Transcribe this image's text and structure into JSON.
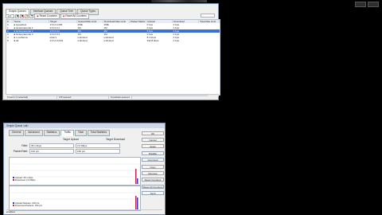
{
  "main": {
    "tabs": [
      "Simple Queues",
      "Interface Queues",
      "Queue Tree",
      "Queue Types"
    ],
    "toolbar": {
      "reset_counters": "Reset Counters",
      "reset_all_counters": "Reset All Counters",
      "search_placeholder": "Find"
    },
    "columns": [
      "#",
      "Name",
      "Target",
      "Upload Max Limit",
      "Download Max Limit",
      "Packet Marks",
      "Upload",
      "Download",
      "Total Max Limit"
    ],
    "rows": [
      {
        "num": "0",
        "name": "speedtest",
        "target": "172.2.0.254",
        "up": "256k",
        "down": "256k",
        "marks": "",
        "upload": "0 bps",
        "download": "0 bps",
        "total": ""
      },
      {
        "num": "1",
        "name": "limiterparental 1",
        "target": "172.2.0.1",
        "up": "1M",
        "down": "1M",
        "marks": "",
        "upload": "0 bps",
        "download": "0 bps",
        "total": ""
      },
      {
        "num": "2",
        "name": "limiterparental 2",
        "target": "172.2.0.2",
        "up": "2M",
        "down": "2M",
        "marks": "",
        "upload": "5 bps",
        "download": "0 bps",
        "total": ""
      },
      {
        "num": "3",
        "name": "limiterparental 3",
        "target": "172.2.0.3",
        "up": "1M",
        "down": "1M",
        "marks": "",
        "upload": "0 bps",
        "download": "0 bps",
        "total": ""
      },
      {
        "num": "4",
        "name": "c-netherna",
        "target": "ether1",
        "up": "unlimited",
        "down": "unlimited",
        "marks": "",
        "upload": "8.4 kbps",
        "download": "0 bps",
        "total": ""
      },
      {
        "num": "5",
        "name": "all",
        "target": "172.2.0.0/24",
        "up": "unlimited",
        "down": "unlimited",
        "marks": "",
        "upload": "932.8 kbps",
        "download": "0 bps",
        "total": ""
      }
    ],
    "status": [
      "6 items (1 selected)",
      "0 B queued",
      "0 packets queued"
    ]
  },
  "dialog": {
    "title": "Simple Queue <all>",
    "tabs": [
      "General",
      "Advanced",
      "Statistics",
      "Traffic",
      "Total",
      "Total Statistics"
    ],
    "target_upload_label": "Target Upload",
    "target_download_label": "Target Download",
    "rate_label": "Rate:",
    "rate_upload": "35.1 kbps",
    "rate_download": "2.6 Mbps",
    "packet_rate_label": "Packet Rate:",
    "packet_rate_upload": "100 p/s",
    "packet_rate_download": "150 p/s",
    "legend1": [
      {
        "label": "Upload: 35.1 kbps",
        "color": "#2c3fb8"
      },
      {
        "label": "Download: 2.6 Mbps",
        "color": "#c0284a"
      }
    ],
    "legend2": [
      {
        "label": "Upload Packets: 100 p/s",
        "color": "#2c3fb8"
      },
      {
        "label": "Download Packets: 150 p/s",
        "color": "#c0284a"
      }
    ],
    "buttons": [
      "OK",
      "Cancel",
      "Apply",
      "Disable",
      "Comment",
      "Copy",
      "Remove",
      "Reset Counters",
      "Reset All Counters",
      "Torch"
    ],
    "status": "enabled"
  }
}
